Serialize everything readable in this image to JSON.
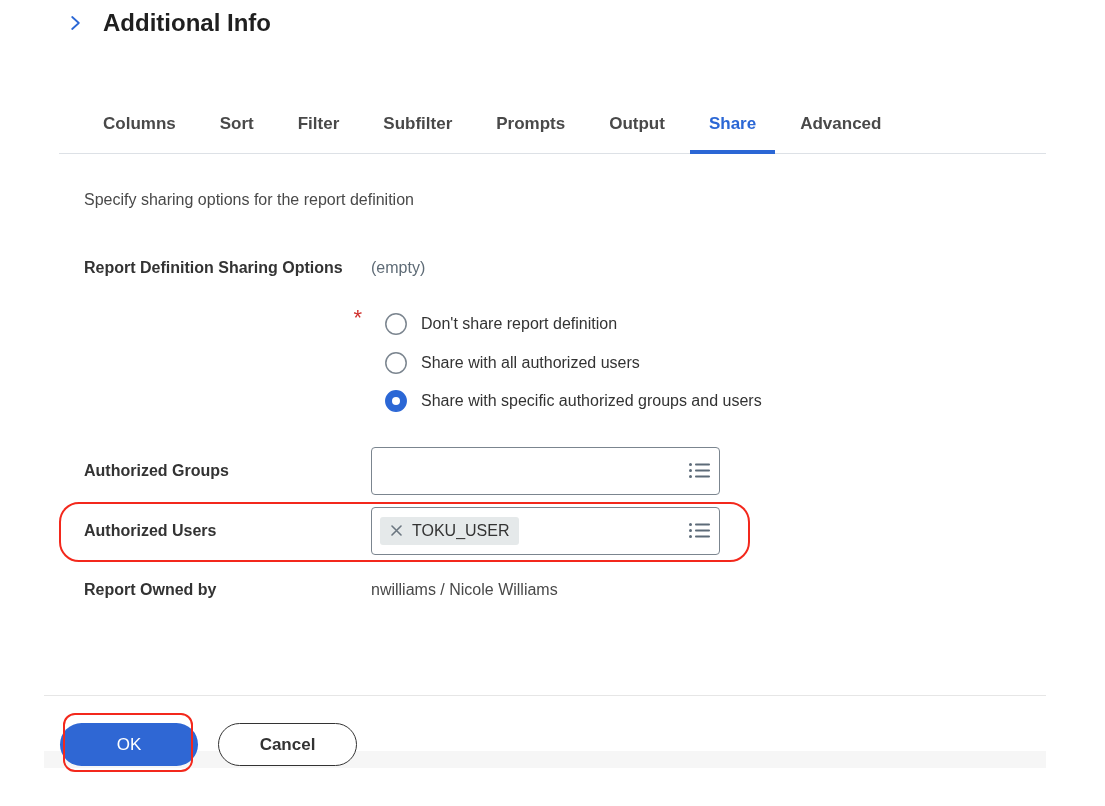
{
  "header": {
    "title": "Additional Info"
  },
  "tabs": [
    {
      "label": "Columns",
      "selected": false
    },
    {
      "label": "Sort",
      "selected": false
    },
    {
      "label": "Filter",
      "selected": false
    },
    {
      "label": "Subfilter",
      "selected": false
    },
    {
      "label": "Prompts",
      "selected": false
    },
    {
      "label": "Output",
      "selected": false
    },
    {
      "label": "Share",
      "selected": true
    },
    {
      "label": "Advanced",
      "selected": false
    }
  ],
  "description": "Specify sharing options for the report definition",
  "sharing_options": {
    "label": "Report Definition Sharing Options",
    "value": "(empty)",
    "required_mark": "*",
    "options": [
      {
        "label": "Don't share report definition",
        "selected": false
      },
      {
        "label": "Share with all authorized users",
        "selected": false
      },
      {
        "label": "Share with specific authorized groups and users",
        "selected": true
      }
    ]
  },
  "fields": [
    {
      "label": "Authorized Groups",
      "highlighted": false
    },
    {
      "label": "Authorized Users",
      "highlighted": true,
      "chips": [
        "TOKU_USER"
      ]
    }
  ],
  "owner": {
    "label": "Report Owned by",
    "value": "nwilliams / Nicole Williams"
  },
  "buttons": [
    {
      "label": "OK",
      "kind": "primary",
      "highlighted": true
    },
    {
      "label": "Cancel",
      "kind": "secondary",
      "highlighted": false
    }
  ]
}
